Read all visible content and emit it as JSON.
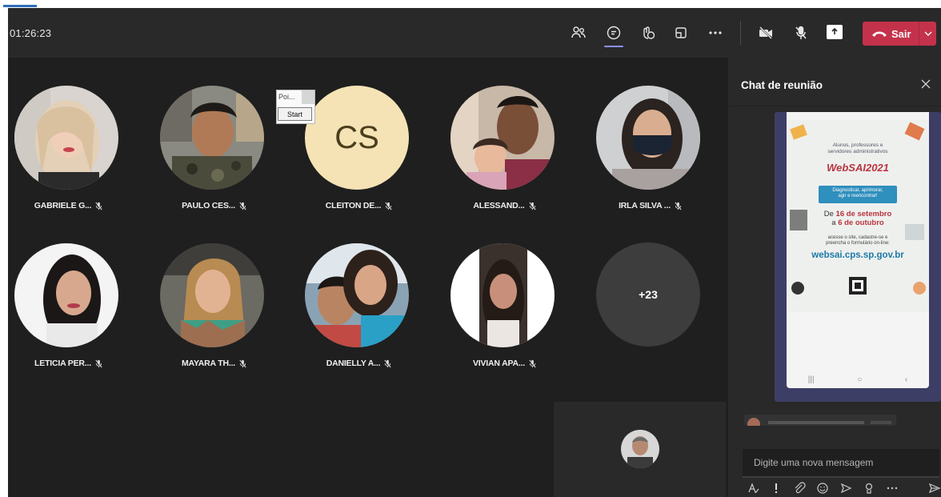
{
  "meeting": {
    "timer": "01:26:23",
    "leave_label": "Sair",
    "overflow_count": "+23"
  },
  "participants": [
    {
      "name": "GABRIELE G...",
      "muted": true
    },
    {
      "name": "PAULO CES...",
      "muted": true
    },
    {
      "name": "CLEITON DE...",
      "initials": "CS",
      "muted": true
    },
    {
      "name": "ALESSAND...",
      "muted": true
    },
    {
      "name": "IRLA SILVA ...",
      "muted": true
    },
    {
      "name": "LETICIA PER...",
      "muted": true
    },
    {
      "name": "MAYARA TH...",
      "muted": true
    },
    {
      "name": "DANIELLY A...",
      "muted": true
    },
    {
      "name": "VIVIAN APA...",
      "muted": true
    }
  ],
  "popup": {
    "title": "Poi...",
    "start_label": "Start"
  },
  "chat": {
    "title": "Chat de reunião",
    "compose_placeholder": "Digite uma nova mensagem"
  },
  "poster": {
    "intro_line1": "Alunos, professores e",
    "intro_line2": "servidores administrativos",
    "logo": "WebSAI2021",
    "box_line1": "Diagnosticar, aprimorar,",
    "box_line2": "agir e reencontrar!",
    "dates_prefix": "De",
    "date_start": "16 de setembro",
    "dates_middle": "a",
    "date_end": "6 de outubro",
    "access_line1": "acesse o site, cadastre-se e",
    "access_line2": "preencha o formulário on-line:",
    "url": "websai.cps.sp.gov.br"
  },
  "colors": {
    "leave": "#c4314b",
    "chat_accent": "#8d8ff7",
    "image_frame": "#3d3e66"
  }
}
